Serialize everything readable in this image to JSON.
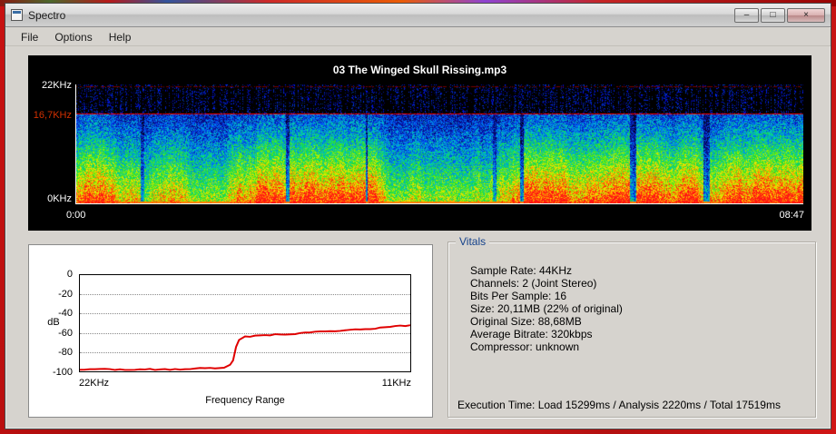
{
  "window": {
    "title": "Spectro",
    "controls": {
      "minimize": "–",
      "maximize": "□",
      "close": "×"
    }
  },
  "menu": {
    "items": [
      {
        "label": "File"
      },
      {
        "label": "Options"
      },
      {
        "label": "Help"
      }
    ]
  },
  "spectrogram": {
    "title": "03 The Winged Skull Rissing.mp3",
    "y_top_label": "22KHz",
    "cutoff_label": "16,7KHz",
    "y_bottom_label": "0KHz",
    "time_start": "0:00",
    "time_end": "08:47"
  },
  "freq_chart": {
    "ylabel": "dB",
    "xlabel": "Frequency Range",
    "x_left": "22KHz",
    "x_right": "11KHz",
    "yticks": [
      "0",
      "-20",
      "-40",
      "-60",
      "-80",
      "-100"
    ]
  },
  "vitals": {
    "title": "Vitals",
    "lines": [
      "Sample Rate: 44KHz",
      "Channels: 2 (Joint Stereo)",
      "Bits Per Sample: 16",
      "Size: 20,11MB (22% of original)",
      "Original Size: 88,68MB",
      "Average Bitrate: 320kbps",
      "Compressor: unknown"
    ],
    "execution": "Execution Time: Load 15299ms / Analysis 2220ms / Total 17519ms"
  },
  "chart_data": [
    {
      "type": "heatmap",
      "subtype": "audio-spectrogram",
      "title": "03 The Winged Skull Rissing.mp3",
      "x_range": [
        "0:00",
        "08:47"
      ],
      "y_axis": "frequency",
      "top_khz": 22,
      "cutoff_khz": 16.7,
      "description": "Dense energy 0-16.7KHz (red/orange low band, green mid, blue/teal upper), sparse blue transient streaks above the 16.7KHz cutoff line, solid red cutoff line at 16.7KHz, occasional quiet vertical gaps"
    },
    {
      "type": "line",
      "title": "Frequency Range",
      "xlabel": "Frequency Range",
      "ylabel": "dB",
      "x_unit": "KHz",
      "x_axis_reversed": true,
      "x": [
        22,
        21,
        20,
        19,
        18,
        17.5,
        17.2,
        17.0,
        16.9,
        16.8,
        16.7,
        16.5,
        16,
        15,
        14,
        13,
        12,
        11
      ],
      "y": [
        -98,
        -98,
        -98,
        -98,
        -97,
        -97,
        -96,
        -93,
        -88,
        -75,
        -67,
        -64,
        -63,
        -61,
        -59,
        -57,
        -55,
        -52
      ],
      "ylim": [
        -100,
        0
      ],
      "grid": "horizontal-dotted",
      "line_color": "#e00000"
    }
  ]
}
